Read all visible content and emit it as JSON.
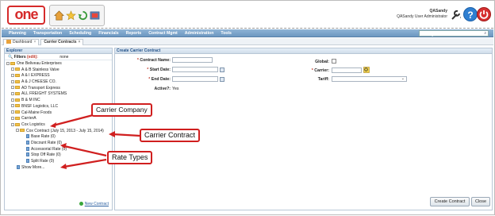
{
  "brand": {
    "logo_text": "one"
  },
  "quick_icons": [
    "home-icon",
    "star-icon",
    "refresh-icon",
    "media-icon"
  ],
  "user": {
    "name": "QASandy",
    "role": "QASandy User Administrator"
  },
  "nav": {
    "items": [
      "Planning",
      "Transportation",
      "Scheduling",
      "Financials",
      "Reports",
      "Contract Mgmt",
      "Administration",
      "Tools"
    ],
    "search_placeholder": "by: Movement No"
  },
  "tabs": [
    {
      "label": "Dashboard",
      "close": "×"
    },
    {
      "label": "Carrier Contracts",
      "close": "×"
    }
  ],
  "explorer": {
    "title": "Explorer",
    "filters_label": "Filters",
    "filters_edit": "(edit):",
    "filters_value": "none",
    "tree": [
      {
        "label": "One Beliveau Enterprises",
        "level": 0,
        "kind": "folder",
        "toggle": "−"
      },
      {
        "label": "A & B Stainless Valve",
        "level": 1,
        "kind": "folder",
        "toggle": "+"
      },
      {
        "label": "A & I EXPRESS",
        "level": 1,
        "kind": "folder",
        "toggle": "+"
      },
      {
        "label": "A & J CHEESE CO.",
        "level": 1,
        "kind": "folder",
        "toggle": "+"
      },
      {
        "label": "AD Transport Express",
        "level": 1,
        "kind": "folder",
        "toggle": "+"
      },
      {
        "label": "ALL FREIGHT SYSTEMS",
        "level": 1,
        "kind": "folder",
        "toggle": "+"
      },
      {
        "label": "B & M INC",
        "level": 1,
        "kind": "folder",
        "toggle": "+"
      },
      {
        "label": "BNSF Logistics, LLC",
        "level": 1,
        "kind": "folder",
        "toggle": "+"
      },
      {
        "label": "Cal-Maine Foods",
        "level": 1,
        "kind": "folder",
        "toggle": "+"
      },
      {
        "label": "CarrierA",
        "level": 1,
        "kind": "folder",
        "toggle": "+"
      },
      {
        "label": "Cox Logistics",
        "level": 1,
        "kind": "folder",
        "toggle": "−"
      },
      {
        "label": "Cox Contract (July 15, 2013 - July 15, 2014)",
        "level": 2,
        "kind": "folder",
        "toggle": "−"
      },
      {
        "label": "Base Rate (0)",
        "level": 3,
        "kind": "doc",
        "toggle": ""
      },
      {
        "label": "Discount Rate (0)",
        "level": 3,
        "kind": "doc",
        "toggle": ""
      },
      {
        "label": "Accessorial Rate (0)",
        "level": 3,
        "kind": "doc",
        "toggle": ""
      },
      {
        "label": "Stop Off Rate (0)",
        "level": 3,
        "kind": "doc",
        "toggle": ""
      },
      {
        "label": "Split Rate (0)",
        "level": 3,
        "kind": "doc",
        "toggle": ""
      },
      {
        "label": "Show More...",
        "level": 1,
        "kind": "doc",
        "toggle": ""
      }
    ],
    "new_contract": "New Contract"
  },
  "form": {
    "title": "Create Carrier Contract",
    "contract_name_label": "Contract Name:",
    "start_date_label": "Start Date:",
    "end_date_label": "End Date:",
    "active_label": "Active?:",
    "active_value": "Yes",
    "global_label": "Global:",
    "carrier_label": "Carrier:",
    "tariff_label": "Tariff:",
    "required_mark": "*",
    "create_button": "Create Contract",
    "close_button": "Close"
  },
  "callouts": {
    "carrier_company": "Carrier Company",
    "carrier_contract": "Carrier Contract",
    "rate_types": "Rate Types"
  },
  "colors": {
    "brand_red": "#d62a2a",
    "nav_blue": "#7aa0c8",
    "callout_red": "#d01f1f"
  }
}
